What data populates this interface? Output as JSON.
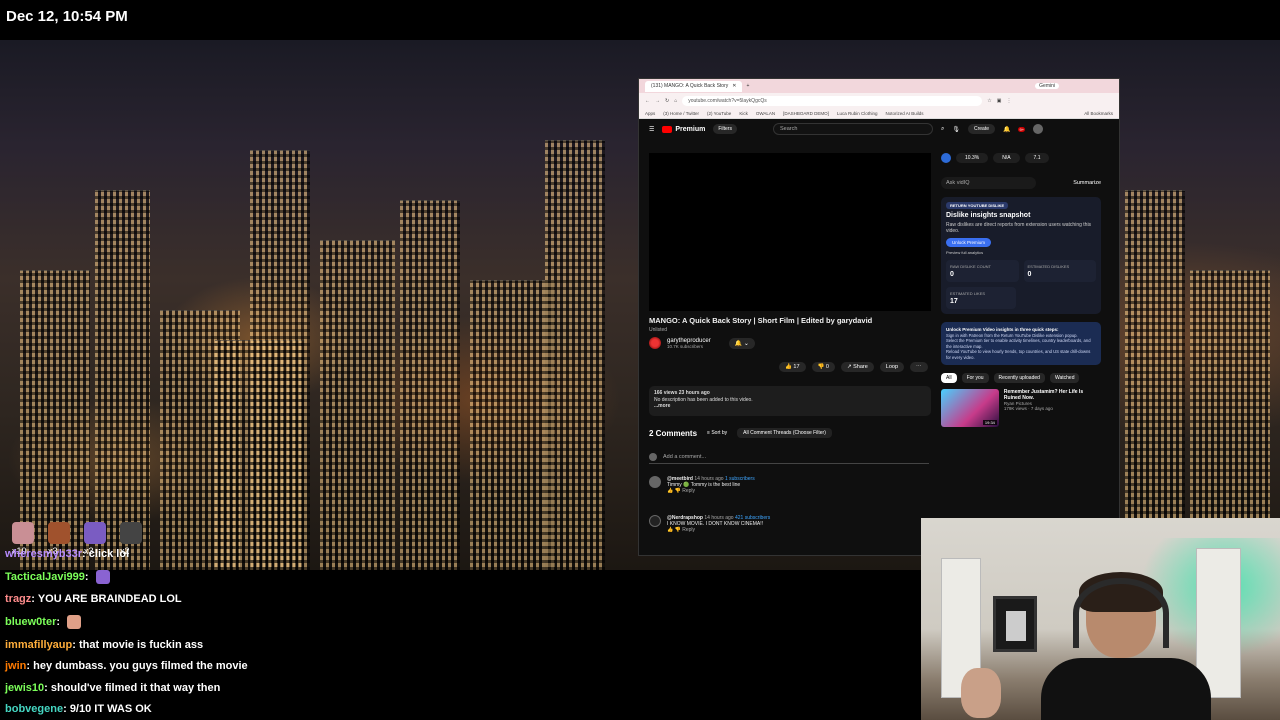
{
  "clock": "Dec 12, 10:54 PM",
  "browser": {
    "tab_title": "(131) MANGO: A Quick Back Story",
    "gemini_label": "Gemini",
    "url": "youtube.com/watch?v=5laykQgcQs",
    "bookmarks": [
      "Apps",
      "(3) Home / Twitter",
      "(2) YouTube",
      "Kick",
      "OWALAN",
      "[DASHBOARD DEMO]",
      "Luca Rubin Clothing",
      "Notorized AI Builds",
      "All Bookmarks"
    ]
  },
  "youtube": {
    "logo": "Premium",
    "filters": "Filters",
    "search_placeholder": "Search",
    "create": "Create",
    "notif_count": "9+",
    "video_title": "MANGO: A Quick Back Story | Short Film | Edited by garydavid",
    "unlisted": "Unlisted",
    "channel_name": "garytheproducer",
    "channel_subs": "10.7K subscribers",
    "likes": "17",
    "dislikes": "0",
    "share": "Share",
    "loop": "Loop",
    "desc_stats": "166 views  23 hours ago",
    "desc_text": "No description has been added to this video.",
    "desc_more": "...more",
    "comments_count": "2 Comments",
    "sort_by": "Sort by",
    "thread_filter": "All Comment Threads (Choose Filter)",
    "add_comment": "Add a comment...",
    "comments": [
      {
        "author": "@meetbird",
        "time": "14 hours ago",
        "subs": "1 subscribers",
        "text": "Timmy 🟢 Tommy  is the best line",
        "reply": "Reply"
      },
      {
        "author": "@Nerdrapshop",
        "time": "14 hours ago",
        "subs": "421 subscribers",
        "text": "I KNOW MOVIE. I DONT KNOW CINEMA!!",
        "reply": "Reply"
      }
    ]
  },
  "sidebar": {
    "stats": [
      "10.3%",
      "N/A",
      "7.1"
    ],
    "ask_placeholder": "Ask vidIQ",
    "summarize": "Summarize",
    "rd_badge": "RETURN YOUTUBE DISLIKE",
    "rd_title": "Dislike insights snapshot",
    "rd_desc": "Raw dislikes are direct reports from extension users watching this video.",
    "unlock": "Unlock Premium",
    "preview": "Preview full analytics",
    "metrics": [
      {
        "label": "RAW DISLIKE COUNT",
        "value": "0"
      },
      {
        "label": "ESTIMATED DISLIKES",
        "value": "0"
      }
    ],
    "est_likes_label": "ESTIMATED LIKES",
    "est_likes_value": "17",
    "steps_title": "Unlock Premium Video insights in three quick steps:",
    "steps": [
      "Sign in with Patreon from the Return YouTube Dislike extension popup.",
      "Select the Premium tier to enable activity timelines, country leaderboards, and the interactive map.",
      "Reload YouTube to view hourly trends, top countries, and US state drill-downs for every video."
    ],
    "chips": [
      "All",
      "For you",
      "Recently uploaded",
      "Watched"
    ],
    "rec_title": "Remember Justamim? Her Life Is Ruined Now.",
    "rec_channel": "Ryan Pictures",
    "rec_meta": "179K views · 7 days ago",
    "rec_duration": "19:34"
  },
  "emotes": [
    {
      "count": "x10",
      "color": "#c98f95"
    },
    {
      "count": "x3",
      "color": "#a0522d"
    },
    {
      "count": "x3",
      "color": "#7a5cc2"
    },
    {
      "count": "x2",
      "color": "#444"
    }
  ],
  "chat": [
    {
      "user": "wheresmyb33r",
      "color": "#b78cff",
      "text": "click lol"
    },
    {
      "user": "TacticalJavi999",
      "color": "#7cff5a",
      "text": "",
      "emote": "#8a63d2"
    },
    {
      "user": "tragz",
      "color": "#ff8c8c",
      "text": "YOU ARE BRAINDEAD LOL"
    },
    {
      "user": "bluew0ter",
      "color": "#7cff5a",
      "text": "",
      "emote": "#e0a088"
    },
    {
      "user": "immafillyaup",
      "color": "#ffae3b",
      "text": "that movie is fuckin ass"
    },
    {
      "user": "jwin",
      "color": "#ff7a00",
      "text": "hey dumbass. you guys filmed the movie"
    },
    {
      "user": "jewis10",
      "color": "#7cff5a",
      "text": "should've filmed it that way then"
    },
    {
      "user": "bobvegene",
      "color": "#45d6c2",
      "text": "9/10 IT WAS OK"
    }
  ]
}
